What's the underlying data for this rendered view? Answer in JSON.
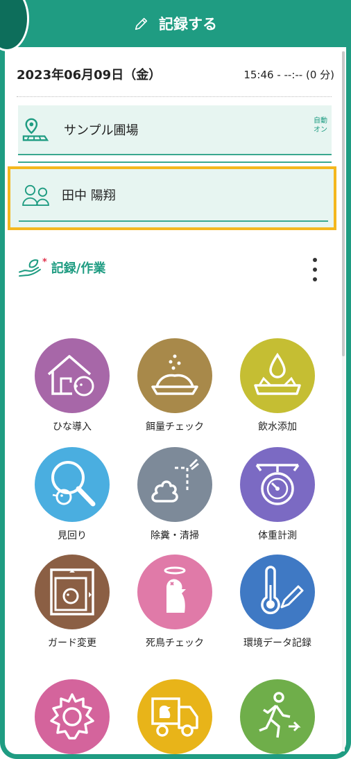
{
  "header": {
    "title": "記録する"
  },
  "record": {
    "date": "2023年06月09日（金）",
    "time": "15:46 - --:-- (0 分)"
  },
  "farm": {
    "name": "サンプル圃場",
    "auto_label_1": "自動",
    "auto_label_2": "オン"
  },
  "person": {
    "name": "田中 陽翔"
  },
  "section": {
    "title": "記録/作業",
    "required_mark": "*"
  },
  "colors": {
    "accent": "#1f9c82",
    "highlight": "#f4b71e",
    "field_bg": "#e7f5f1"
  },
  "tiles": [
    {
      "label": "ひな導入",
      "icon": "chick-intake-icon",
      "color": "#a767a8"
    },
    {
      "label": "餌量チェック",
      "icon": "feed-bowl-icon",
      "color": "#a8894a"
    },
    {
      "label": "飲水添加",
      "icon": "water-additive-icon",
      "color": "#c5be33"
    },
    {
      "label": "見回り",
      "icon": "magnifier-chick-icon",
      "color": "#4aaee0"
    },
    {
      "label": "除糞・清掃",
      "icon": "waste-spray-icon",
      "color": "#7d8a99"
    },
    {
      "label": "体重計測",
      "icon": "scale-icon",
      "color": "#7b6ac3"
    },
    {
      "label": "ガード変更",
      "icon": "guard-chick-icon",
      "color": "#8b5f44"
    },
    {
      "label": "死鳥チェック",
      "icon": "dead-chick-icon",
      "color": "#e07aa8"
    },
    {
      "label": "環境データ記録",
      "icon": "thermometer-pen-icon",
      "color": "#3f79c4"
    },
    {
      "label": "",
      "icon": "gear-icon",
      "color": "#d4649c"
    },
    {
      "label": "",
      "icon": "truck-chick-icon",
      "color": "#e8b419"
    },
    {
      "label": "",
      "icon": "walking-person-icon",
      "color": "#6fae4a"
    }
  ]
}
